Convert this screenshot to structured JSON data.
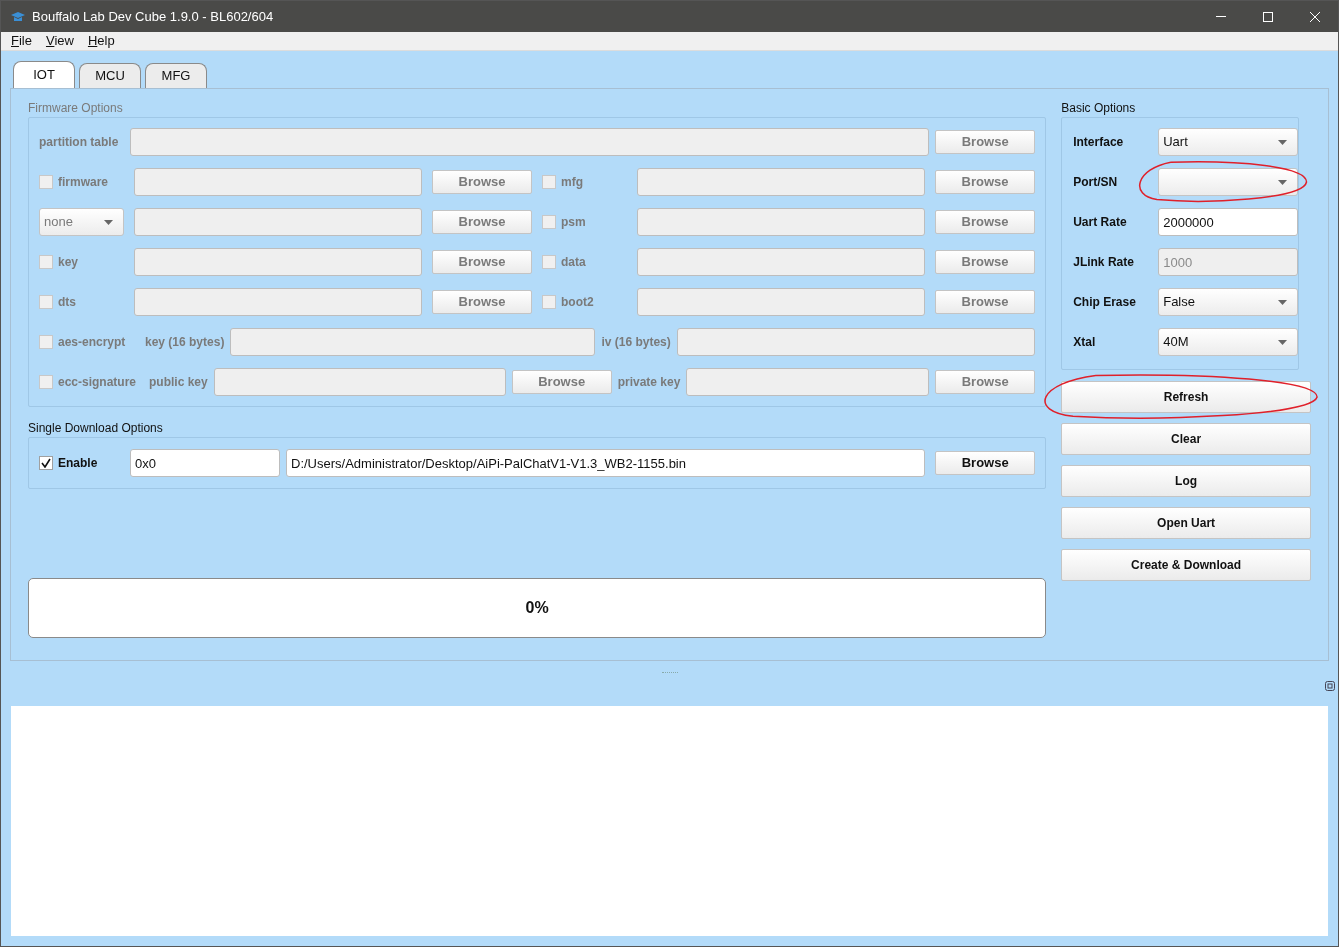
{
  "window": {
    "title": "Bouffalo Lab Dev Cube 1.9.0 - BL602/604"
  },
  "menu": [
    {
      "label": "File"
    },
    {
      "label": "View"
    },
    {
      "label": "Help"
    }
  ],
  "tabs": [
    {
      "label": "IOT",
      "selected": true
    },
    {
      "label": "MCU",
      "selected": false
    },
    {
      "label": "MFG",
      "selected": false
    }
  ],
  "firmware_options": {
    "title": "Firmware Options",
    "disabled": true,
    "partition_table": {
      "label": "partition table",
      "button": "Browse"
    },
    "file_rows": [
      {
        "left": {
          "kind": "checkbox",
          "label": "firmware",
          "checked": false
        },
        "left_button": "Browse",
        "right": {
          "label": "mfg",
          "checked": false
        },
        "right_button": "Browse"
      },
      {
        "left": {
          "kind": "select",
          "value": "none"
        },
        "left_button": "Browse",
        "right": {
          "label": "psm",
          "checked": false
        },
        "right_button": "Browse"
      },
      {
        "left": {
          "kind": "checkbox",
          "label": "key",
          "checked": false
        },
        "left_button": "Browse",
        "right": {
          "label": "data",
          "checked": false
        },
        "right_button": "Browse"
      },
      {
        "left": {
          "kind": "checkbox",
          "label": "dts",
          "checked": false
        },
        "left_button": "Browse",
        "right": {
          "label": "boot2",
          "checked": false
        },
        "right_button": "Browse"
      }
    ],
    "aes": {
      "label": "aes-encrypt",
      "checked": false,
      "key_label": "key (16 bytes)",
      "iv_label": "iv (16 bytes)"
    },
    "ecc": {
      "label": "ecc-signature",
      "checked": false,
      "public_label": "public key",
      "public_button": "Browse",
      "private_label": "private key",
      "private_button": "Browse"
    }
  },
  "single_download": {
    "title": "Single Download Options",
    "enable": {
      "label": "Enable",
      "checked": true
    },
    "address": "0x0",
    "path": "D:/Users/Administrator/Desktop/AiPi-PalChatV1-V1.3_WB2-1155.bin",
    "button": "Browse"
  },
  "progress": {
    "level": 0,
    "text": "0%"
  },
  "basic_options": {
    "title": "Basic Options",
    "fields": [
      {
        "label": "Interface",
        "kind": "select",
        "value": "Uart",
        "circled": false
      },
      {
        "label": "Port/SN",
        "kind": "select",
        "circled": true
      },
      {
        "label": "Uart Rate",
        "kind": "input",
        "value": "2000000",
        "disabled": false,
        "circled": false
      },
      {
        "label": "JLink Rate",
        "kind": "input",
        "value": "1000",
        "disabled": true,
        "circled": false
      },
      {
        "label": "Chip Erase",
        "kind": "select",
        "value": "False",
        "circled": false
      },
      {
        "label": "Xtal",
        "kind": "select",
        "value": "40M",
        "circled": false
      }
    ]
  },
  "buttons": [
    {
      "label": "Refresh",
      "circled": true
    },
    {
      "label": "Clear",
      "circled": false
    },
    {
      "label": "Log",
      "circled": false
    },
    {
      "label": "Open Uart",
      "circled": false
    },
    {
      "label": "Create & Download",
      "circled": false
    }
  ]
}
